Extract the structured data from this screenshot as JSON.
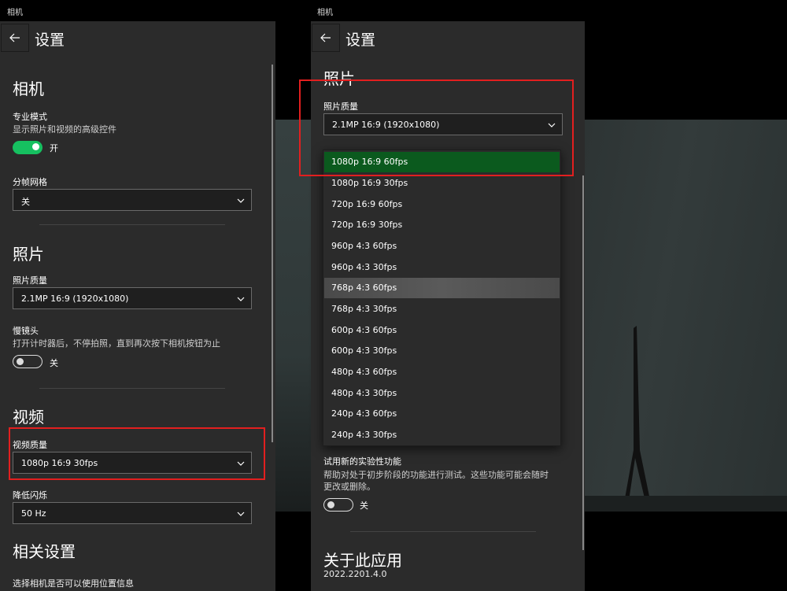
{
  "left_window": {
    "app_title": "相机",
    "header_title": "设置",
    "camera_section": {
      "title": "相机",
      "pro_mode_label": "专业模式",
      "pro_mode_desc": "显示照片和视频的高级控件",
      "pro_mode_state": "开",
      "framing_grid_label": "分帧网格",
      "framing_grid_value": "关"
    },
    "photo_section": {
      "title": "照片",
      "quality_label": "照片质量",
      "quality_value": "2.1MP 16:9 (1920x1080)",
      "timelapse_label": "慢镜头",
      "timelapse_desc": "打开计时器后，不停拍照，直到再次按下相机按钮为止",
      "timelapse_state": "关"
    },
    "video_section": {
      "title": "视频",
      "quality_label": "视频质量",
      "quality_value": "1080p 16:9 30fps",
      "flicker_label": "降低闪烁",
      "flicker_value": "50 Hz"
    },
    "related_section": {
      "title": "相关设置",
      "location_link": "选择相机是否可以使用位置信息"
    }
  },
  "right_window": {
    "app_title": "相机",
    "header_title": "设置",
    "photo_section": {
      "title": "照片",
      "quality_label": "照片质量",
      "quality_value": "2.1MP 16:9 (1920x1080)"
    },
    "video_quality_options": [
      "1080p 16:9 60fps",
      "1080p 16:9 30fps",
      "720p 16:9 60fps",
      "720p 16:9 30fps",
      "960p 4:3 60fps",
      "960p 4:3 30fps",
      "768p 4:3 60fps",
      "768p 4:3 30fps",
      "600p 4:3 60fps",
      "600p 4:3 30fps",
      "480p 4:3 60fps",
      "480p 4:3 30fps",
      "240p 4:3 60fps",
      "240p 4:3 30fps"
    ],
    "experimental": {
      "label": "试用新的实验性功能",
      "desc_line1": "帮助对处于初步阶段的功能进行测试。这些功能可能会随时",
      "desc_line2": "更改或删除。",
      "state": "关"
    },
    "about": {
      "title": "关于此应用",
      "version": "2022.2201.4.0"
    }
  },
  "colors": {
    "panel_bg": "#2b2b2b",
    "toggle_on": "#16c060",
    "selected_option": "#0b5a1e",
    "highlight_box": "#e21f1f"
  }
}
